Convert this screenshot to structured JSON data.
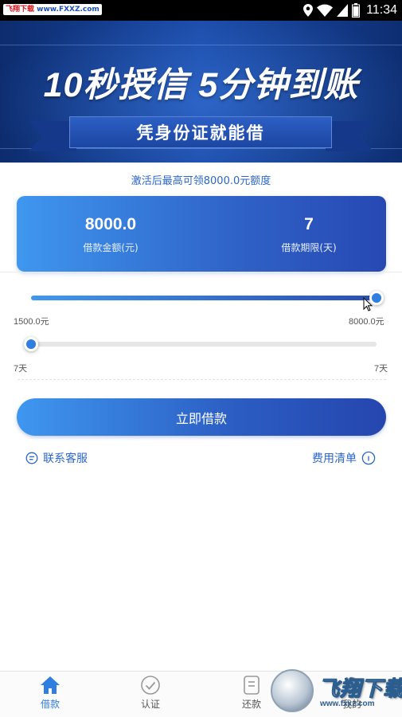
{
  "status_bar": {
    "site_tag_brand": "飞翔下载",
    "site_tag_url": "www.FXXZ.com",
    "time": "11:34",
    "icons": [
      "location-icon",
      "wifi-icon",
      "signal-icon",
      "battery-icon"
    ]
  },
  "banner": {
    "headline": "10秒授信 5分钟到账",
    "ribbon": "凭身份证就能借"
  },
  "credit_tip": "激活后最高可领8000.0元额度",
  "loan_card": {
    "amount_value": "8000.0",
    "amount_label": "借款金额(元)",
    "term_value": "7",
    "term_label": "借款期限(天)"
  },
  "amount_slider": {
    "min_label": "1500.0元",
    "max_label": "8000.0元",
    "min": 1500,
    "max": 8000,
    "value": 8000
  },
  "term_slider": {
    "min_label": "7天",
    "max_label": "7天",
    "min": 7,
    "max": 7,
    "value": 7
  },
  "borrow_button": "立即借款",
  "links": {
    "customer_service": "联系客服",
    "fee_list": "费用清单"
  },
  "bottom_nav": {
    "items": [
      {
        "label": "借款",
        "icon": "home-icon",
        "active": true
      },
      {
        "label": "认证",
        "icon": "check-circle-icon",
        "active": false
      },
      {
        "label": "还款",
        "icon": "wallet-icon",
        "active": false
      },
      {
        "label": "我的",
        "icon": "user-icon",
        "active": false
      }
    ]
  },
  "watermark": {
    "brand": "飞翔下载",
    "url": "www.fxxz.com"
  },
  "colors": {
    "primary": "#2f7ee0",
    "link": "#2a66c9",
    "banner_dark": "#0d2c6e"
  }
}
